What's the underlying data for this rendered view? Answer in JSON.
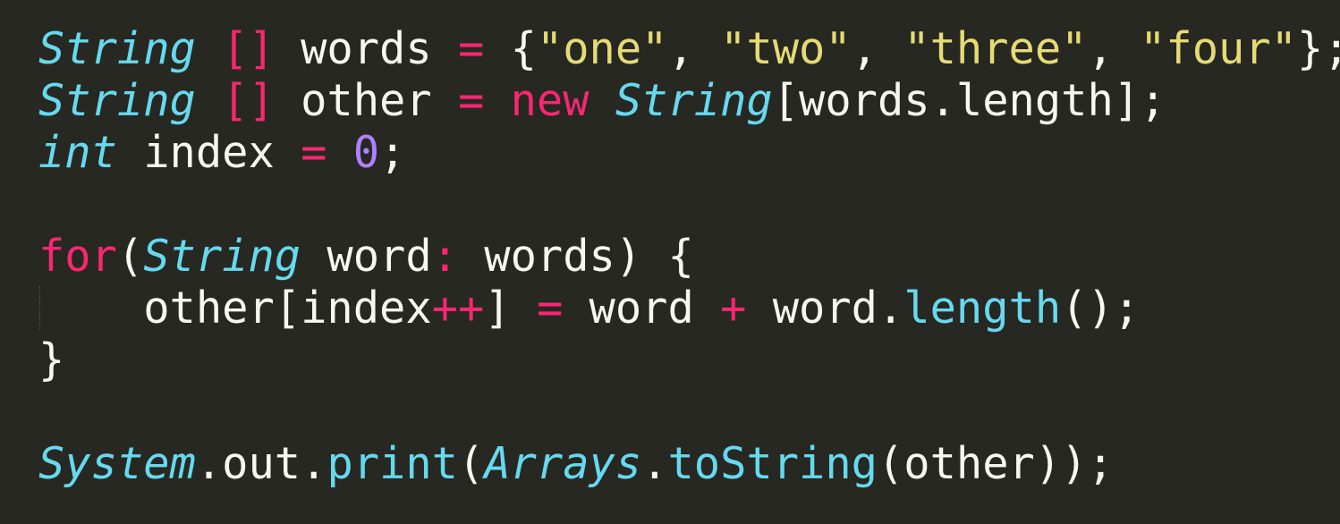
{
  "editor": {
    "theme_colors": {
      "background": "#272822",
      "foreground": "#f8f8f2",
      "keyword": "#f92672",
      "type": "#66d9ef",
      "string": "#e6db74",
      "number": "#ae81ff"
    },
    "lines": [
      {
        "tokens": [
          {
            "text": "String",
            "kind": "type"
          },
          {
            "text": " ",
            "kind": "plain"
          },
          {
            "text": "[]",
            "kind": "op"
          },
          {
            "text": " words ",
            "kind": "plain"
          },
          {
            "text": "=",
            "kind": "op"
          },
          {
            "text": " {",
            "kind": "plain"
          },
          {
            "text": "\"one\"",
            "kind": "str"
          },
          {
            "text": ", ",
            "kind": "plain"
          },
          {
            "text": "\"two\"",
            "kind": "str"
          },
          {
            "text": ", ",
            "kind": "plain"
          },
          {
            "text": "\"three\"",
            "kind": "str"
          },
          {
            "text": ", ",
            "kind": "plain"
          },
          {
            "text": "\"four\"",
            "kind": "str"
          },
          {
            "text": "};",
            "kind": "plain"
          }
        ]
      },
      {
        "tokens": [
          {
            "text": "String",
            "kind": "type"
          },
          {
            "text": " ",
            "kind": "plain"
          },
          {
            "text": "[]",
            "kind": "op"
          },
          {
            "text": " other ",
            "kind": "plain"
          },
          {
            "text": "=",
            "kind": "op"
          },
          {
            "text": " ",
            "kind": "plain"
          },
          {
            "text": "new",
            "kind": "kw"
          },
          {
            "text": " ",
            "kind": "plain"
          },
          {
            "text": "String",
            "kind": "type"
          },
          {
            "text": "[words.length];",
            "kind": "plain"
          }
        ]
      },
      {
        "tokens": [
          {
            "text": "int",
            "kind": "type"
          },
          {
            "text": " index ",
            "kind": "plain"
          },
          {
            "text": "=",
            "kind": "op"
          },
          {
            "text": " ",
            "kind": "plain"
          },
          {
            "text": "0",
            "kind": "num"
          },
          {
            "text": ";",
            "kind": "plain"
          }
        ]
      },
      {
        "tokens": []
      },
      {
        "tokens": [
          {
            "text": "for",
            "kind": "kw"
          },
          {
            "text": "(",
            "kind": "plain"
          },
          {
            "text": "String",
            "kind": "type"
          },
          {
            "text": " word",
            "kind": "plain"
          },
          {
            "text": ":",
            "kind": "op"
          },
          {
            "text": " words) {",
            "kind": "plain"
          }
        ]
      },
      {
        "tokens": [
          {
            "text": "    other[index",
            "kind": "plain"
          },
          {
            "text": "++",
            "kind": "op"
          },
          {
            "text": "] ",
            "kind": "plain"
          },
          {
            "text": "=",
            "kind": "op"
          },
          {
            "text": " word ",
            "kind": "plain"
          },
          {
            "text": "+",
            "kind": "op"
          },
          {
            "text": " word.",
            "kind": "plain"
          },
          {
            "text": "length",
            "kind": "fn"
          },
          {
            "text": "();",
            "kind": "plain"
          }
        ]
      },
      {
        "tokens": [
          {
            "text": "}",
            "kind": "plain"
          }
        ]
      },
      {
        "tokens": []
      },
      {
        "tokens": [
          {
            "text": "System",
            "kind": "type"
          },
          {
            "text": ".out.",
            "kind": "plain"
          },
          {
            "text": "print",
            "kind": "fn"
          },
          {
            "text": "(",
            "kind": "plain"
          },
          {
            "text": "Arrays",
            "kind": "type"
          },
          {
            "text": ".",
            "kind": "plain"
          },
          {
            "text": "toString",
            "kind": "fn"
          },
          {
            "text": "(other));",
            "kind": "plain"
          }
        ]
      }
    ]
  }
}
